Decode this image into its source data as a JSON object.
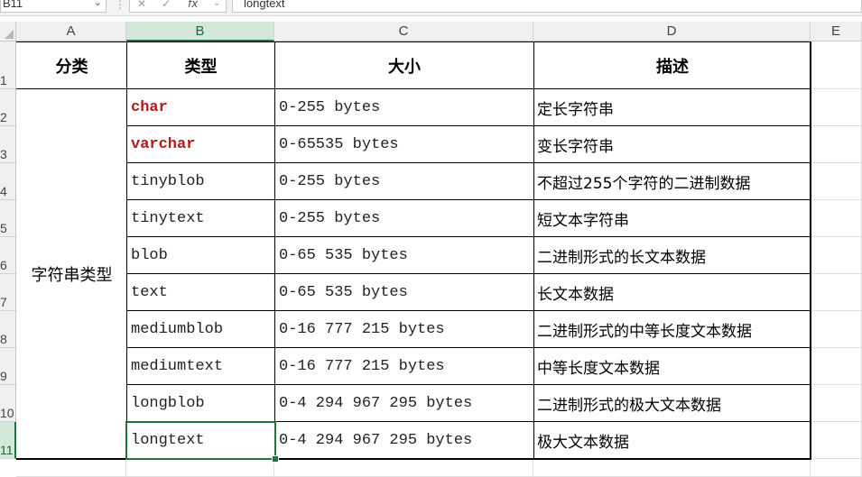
{
  "formula_bar": {
    "name_box": "B11",
    "fx_label": "fx",
    "formula_value": "longtext"
  },
  "columns": [
    "A",
    "B",
    "C",
    "D",
    "E"
  ],
  "rows": [
    "1",
    "2",
    "3",
    "4",
    "5",
    "6",
    "7",
    "8",
    "9",
    "10",
    "11"
  ],
  "selected_cell": "B11",
  "table": {
    "headers": [
      "分类",
      "类型",
      "大小",
      "描述"
    ],
    "category": "字符串类型",
    "rows": [
      {
        "type": "char",
        "size": "0-255 bytes",
        "desc": "定长字符串",
        "highlight": true
      },
      {
        "type": "varchar",
        "size": "0-65535 bytes",
        "desc": "变长字符串",
        "highlight": true
      },
      {
        "type": "tinyblob",
        "size": "0-255 bytes",
        "desc": "不超过255个字符的二进制数据",
        "highlight": false
      },
      {
        "type": "tinytext",
        "size": "0-255 bytes",
        "desc": "短文本字符串",
        "highlight": false
      },
      {
        "type": "blob",
        "size": "0-65 535 bytes",
        "desc": "二进制形式的长文本数据",
        "highlight": false
      },
      {
        "type": "text",
        "size": "0-65 535 bytes",
        "desc": "长文本数据",
        "highlight": false
      },
      {
        "type": "mediumblob",
        "size": "0-16 777 215 bytes",
        "desc": "二进制形式的中等长度文本数据",
        "highlight": false
      },
      {
        "type": "mediumtext",
        "size": "0-16 777 215 bytes",
        "desc": "中等长度文本数据",
        "highlight": false
      },
      {
        "type": "longblob",
        "size": "0-4 294 967 295 bytes",
        "desc": "二进制形式的极大文本数据",
        "highlight": false
      },
      {
        "type": "longtext",
        "size": "0-4 294 967 295 bytes",
        "desc": "极大文本数据",
        "highlight": false
      }
    ]
  },
  "colors": {
    "highlight_text": "#b11b1b",
    "selection": "#217346"
  }
}
